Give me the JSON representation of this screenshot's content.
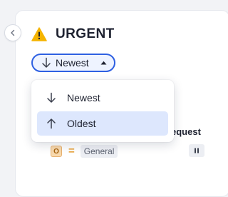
{
  "section": {
    "title": "URGENT",
    "icon": "warning-icon"
  },
  "sort": {
    "current_label": "Newest",
    "icon": "arrow-down-icon",
    "caret_icon": "caret-up-icon"
  },
  "sort_menu": {
    "options": [
      {
        "label": "Newest",
        "icon": "arrow-down-icon",
        "selected": false
      },
      {
        "label": "Oldest",
        "icon": "arrow-up-icon",
        "selected": true
      }
    ]
  },
  "task": {
    "title_fragment": "equest",
    "priority_badge": "O",
    "category_tag": "General",
    "status_icon": "pause-icon"
  },
  "colors": {
    "accent": "#2e60e2",
    "selected_bg": "#dde7fd",
    "warning": "#f5b400",
    "priority": "#e8a33c"
  }
}
